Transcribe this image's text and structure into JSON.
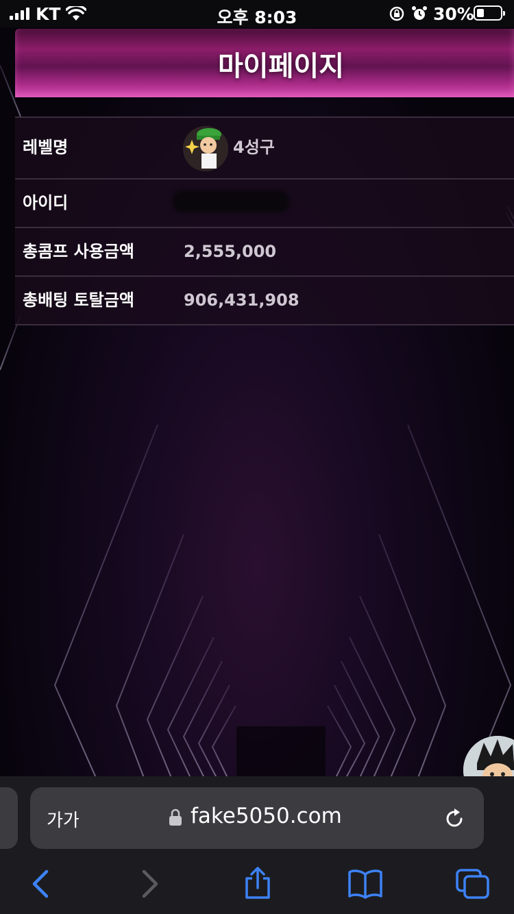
{
  "status_bar": {
    "carrier": "KT",
    "time": "오후 8:03",
    "battery_percent_label": "30%",
    "battery_level": 0.3,
    "icons": [
      "cellular-signal-icon",
      "wifi-icon",
      "orientation-lock-icon",
      "alarm-icon",
      "battery-icon"
    ]
  },
  "header": {
    "title": "마이페이지"
  },
  "info": {
    "level_label": "레벨명",
    "level_value": "4성구",
    "id_label": "아이디",
    "comp_label": "총콤프 사용금액",
    "comp_value": "2,555,000",
    "betting_label": "총배팅 토탈금액",
    "betting_value": "906,431,908"
  },
  "browser": {
    "text_size_label": "가가",
    "url": "fake5050.com",
    "icons": [
      "lock-icon",
      "reload-icon",
      "back-icon",
      "forward-icon",
      "share-icon",
      "bookmarks-icon",
      "tabs-icon"
    ]
  },
  "colors": {
    "header_pink": "#a82a86",
    "toolbar_blue": "#3d82f6",
    "background": "#07040c"
  }
}
